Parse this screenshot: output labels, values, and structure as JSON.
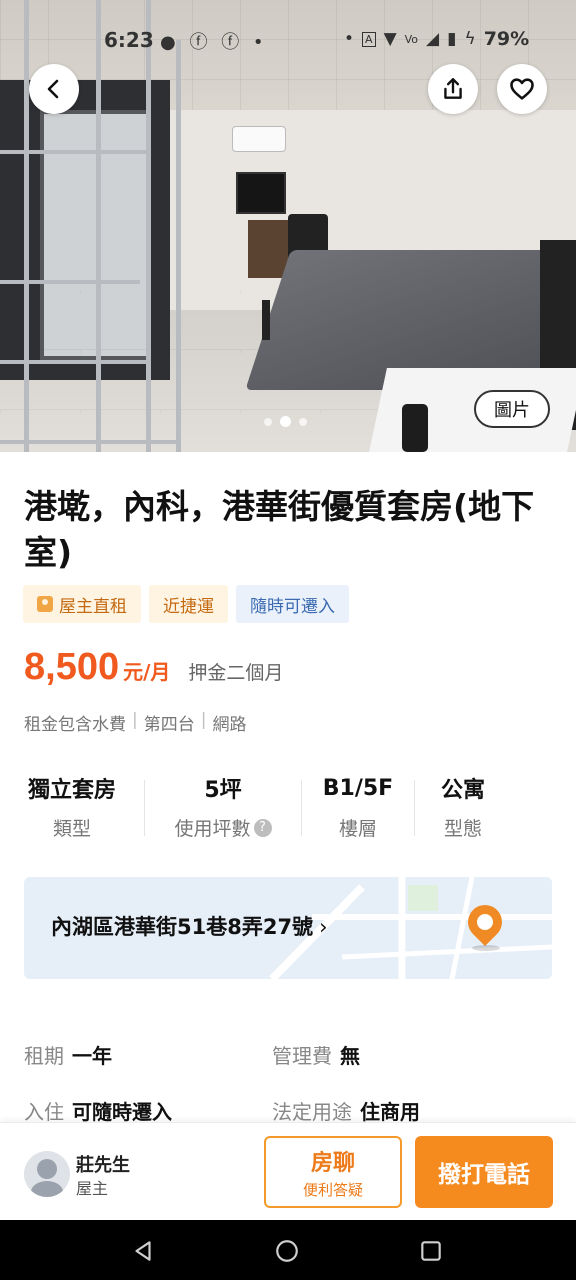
{
  "status_bar": {
    "time": "6:23",
    "icons_left": [
      "chat-bubble-icon",
      "facebook-icon",
      "facebook-icon",
      "dot-icon"
    ],
    "battery": "79%"
  },
  "gallery": {
    "photo_button_label": "圖片",
    "dots": 3,
    "active_index": 1
  },
  "listing": {
    "title": "港墘，內科，港華街優質套房(地下室)",
    "tags": [
      "屋主直租",
      "近捷運",
      "隨時可遷入"
    ],
    "price": "8,500",
    "price_unit": "元/月",
    "deposit": "押金二個月",
    "includes": [
      "租金包含水費",
      "第四台",
      "網路"
    ],
    "specs": [
      {
        "value": "獨立套房",
        "label": "類型"
      },
      {
        "value": "5坪",
        "label": "使用坪數"
      },
      {
        "value": "B1/5F",
        "label": "樓層"
      },
      {
        "value": "公寓",
        "label": "型態"
      }
    ],
    "address": "內湖區港華街51巷8弄27號",
    "info": [
      {
        "key": "租期",
        "value": "一年"
      },
      {
        "key": "管理費",
        "value": "無"
      },
      {
        "key": "入住",
        "value": "可隨時遷入"
      },
      {
        "key": "法定用途",
        "value": "住商用"
      }
    ]
  },
  "contact": {
    "name": "莊先生",
    "role": "屋主",
    "chat_main": "房聊",
    "chat_sub": "便利答疑",
    "call_label": "撥打電話"
  },
  "colors": {
    "accent": "#f58a1f",
    "price": "#f05a1e"
  }
}
